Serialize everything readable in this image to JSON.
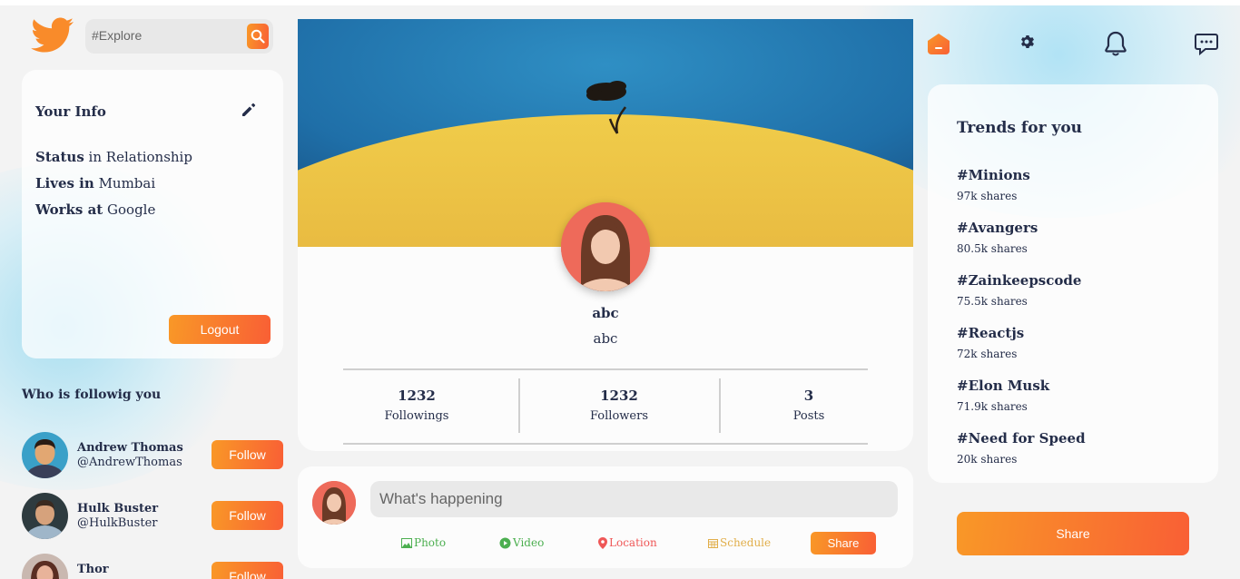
{
  "search": {
    "placeholder": "#Explore"
  },
  "info": {
    "title": "Your Info",
    "rows": [
      {
        "key": "Status",
        "value": "in Relationship"
      },
      {
        "key": "Lives in",
        "value": "Mumbai"
      },
      {
        "key": "Works at",
        "value": "Google"
      }
    ],
    "logout_label": "Logout"
  },
  "followers": {
    "title": "Who is followig you",
    "items": [
      {
        "name": "Andrew Thomas",
        "handle": "@AndrewThomas",
        "button": "Follow"
      },
      {
        "name": "Hulk Buster",
        "handle": "@HulkBuster",
        "button": "Follow"
      },
      {
        "name": "Thor",
        "handle": "",
        "button": "Follow"
      }
    ]
  },
  "profile": {
    "name": "abc",
    "handle": "abc",
    "stats": [
      {
        "value": "1232",
        "label": "Followings"
      },
      {
        "value": "1232",
        "label": "Followers"
      },
      {
        "value": "3",
        "label": "Posts"
      }
    ]
  },
  "post": {
    "placeholder": "What's happening",
    "options": [
      {
        "label": "Photo",
        "color": "#4caf50"
      },
      {
        "label": "Video",
        "color": "#4caf50"
      },
      {
        "label": "Location",
        "color": "#ef5757"
      },
      {
        "label": "Schedule",
        "color": "#e1ae4a"
      }
    ],
    "share_label": "Share"
  },
  "trends": {
    "title": "Trends for you",
    "items": [
      {
        "tag": "#Minions",
        "shares": "97k shares"
      },
      {
        "tag": "#Avangers",
        "shares": "80.5k shares"
      },
      {
        "tag": "#Zainkeepscode",
        "shares": "75.5k shares"
      },
      {
        "tag": "#Reactjs",
        "shares": "72k shares"
      },
      {
        "tag": "#Elon Musk",
        "shares": "71.9k shares"
      },
      {
        "tag": "#Need for Speed",
        "shares": "20k shares"
      }
    ]
  },
  "share_button": "Share",
  "colors": {
    "accent_start": "#f99827",
    "accent_end": "#f95f35",
    "text": "#242d49"
  }
}
